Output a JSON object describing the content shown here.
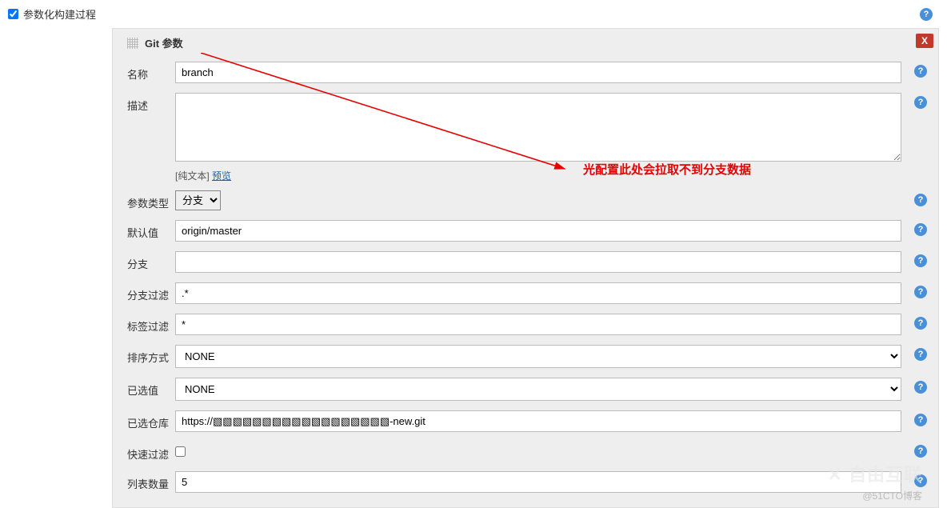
{
  "top": {
    "checkbox_label": "参数化构建过程",
    "checked": true
  },
  "block": {
    "title": "Git 参数",
    "close_label": "X"
  },
  "annotation": {
    "text": "光配置此处会拉取不到分支数据"
  },
  "fields": {
    "name": {
      "label": "名称",
      "value": "branch"
    },
    "desc": {
      "label": "描述",
      "value": "",
      "meta_plain": "[纯文本] ",
      "meta_preview": "预览"
    },
    "param_type": {
      "label": "参数类型",
      "selected": "分支",
      "options": [
        "分支"
      ]
    },
    "default": {
      "label": "默认值",
      "value": "origin/master"
    },
    "branch": {
      "label": "分支",
      "value": ""
    },
    "branch_filter": {
      "label": "分支过滤",
      "value": ".*"
    },
    "tag_filter": {
      "label": "标签过滤",
      "value": "*"
    },
    "sort": {
      "label": "排序方式",
      "selected": "NONE",
      "options": [
        "NONE"
      ]
    },
    "selected_val": {
      "label": "已选值",
      "selected": "NONE",
      "options": [
        "NONE"
      ]
    },
    "repo": {
      "label": "已选仓库",
      "value": "https://▧▧▧▧▧▧▧▧▧▧▧▧▧▧▧▧▧▧-new.git"
    },
    "quick_filter": {
      "label": "快速过滤",
      "checked": false
    },
    "list_count": {
      "label": "列表数量",
      "value": "5"
    }
  },
  "watermark": {
    "logo": "✕ 自由互联",
    "text": "@51CTO博客"
  }
}
